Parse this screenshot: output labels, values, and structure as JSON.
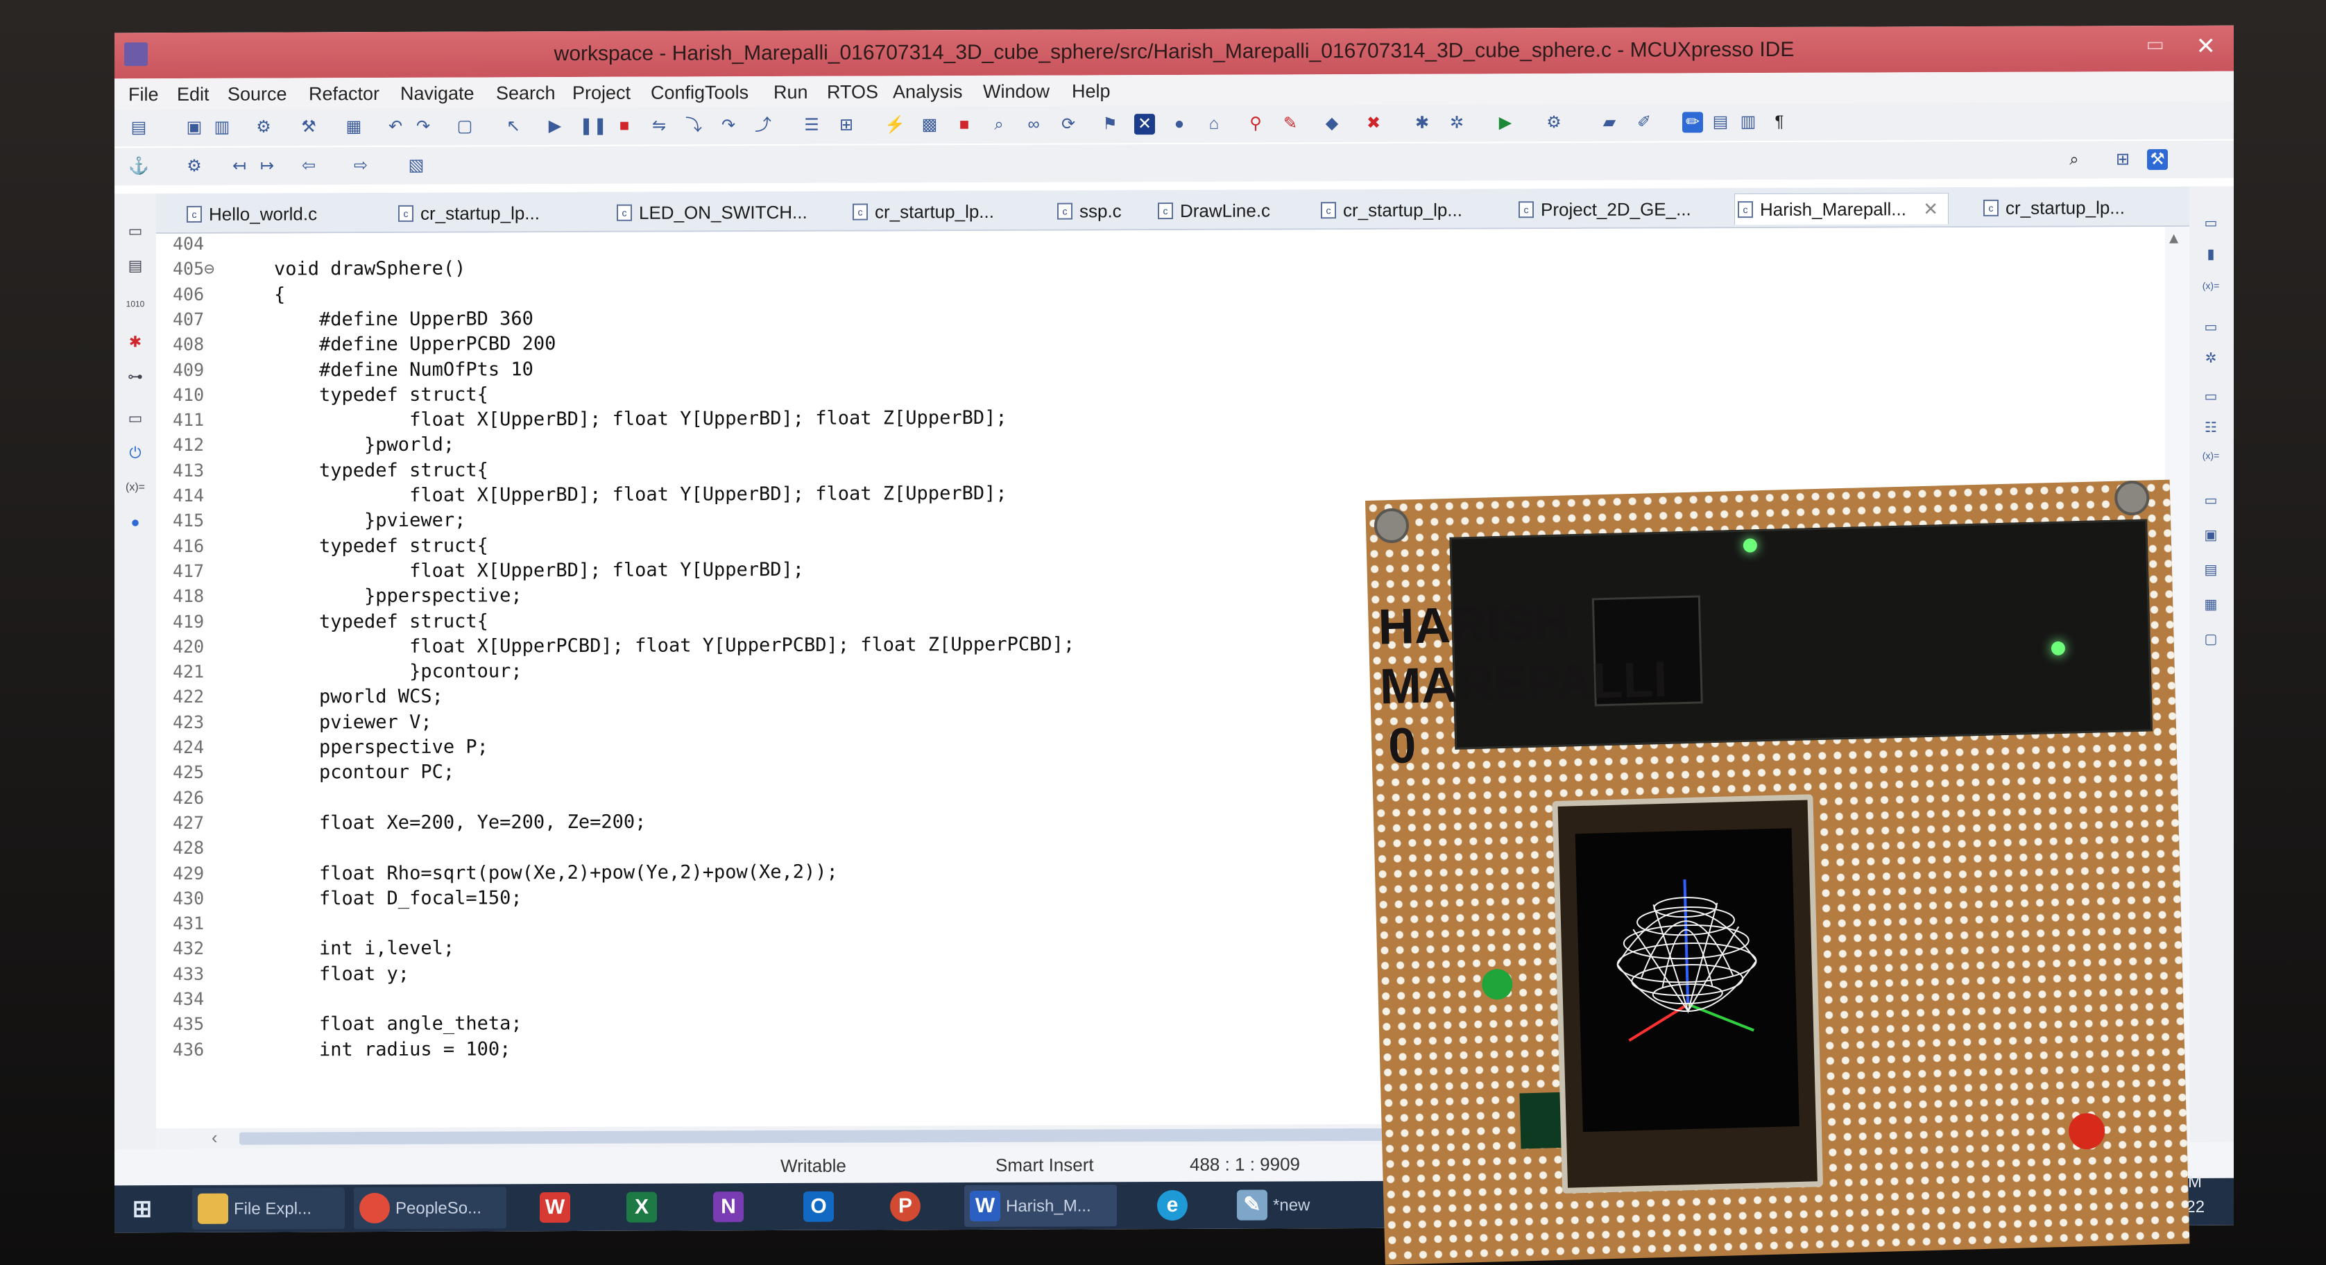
{
  "window": {
    "title": "workspace - Harish_Marepalli_016707314_3D_cube_sphere/src/Harish_Marepalli_016707314_3D_cube_sphere.c - MCUXpresso IDE",
    "close_glyph": "✕",
    "max_glyph": "▭"
  },
  "menu": [
    "File",
    "Edit",
    "Source",
    "Refactor",
    "Navigate",
    "Search",
    "Project",
    "ConfigTools",
    "Run",
    "RTOS",
    "Analysis",
    "Window",
    "Help"
  ],
  "tabs": [
    {
      "label": "Hello_world.c"
    },
    {
      "label": "cr_startup_lp..."
    },
    {
      "label": "LED_ON_SWITCH..."
    },
    {
      "label": "cr_startup_lp..."
    },
    {
      "label": "ssp.c"
    },
    {
      "label": "DrawLine.c"
    },
    {
      "label": "cr_startup_lp..."
    },
    {
      "label": "Project_2D_GE_..."
    },
    {
      "label": "Harish_Marepall...",
      "active": true
    },
    {
      "label": "cr_startup_lp..."
    }
  ],
  "tab_close_glyph": "✕",
  "file_icon_glyph": "c",
  "code_lines": [
    {
      "n": "404",
      "t": ""
    },
    {
      "n": "405⊖",
      "t": "void drawSphere()"
    },
    {
      "n": "406",
      "t": "{"
    },
    {
      "n": "407",
      "t": "    #define UpperBD 360"
    },
    {
      "n": "408",
      "t": "    #define UpperPCBD 200"
    },
    {
      "n": "409",
      "t": "    #define NumOfPts 10"
    },
    {
      "n": "410",
      "t": "    typedef struct{"
    },
    {
      "n": "411",
      "t": "            float X[UpperBD]; float Y[UpperBD]; float Z[UpperBD];"
    },
    {
      "n": "412",
      "t": "        }pworld;"
    },
    {
      "n": "413",
      "t": "    typedef struct{"
    },
    {
      "n": "414",
      "t": "            float X[UpperBD]; float Y[UpperBD]; float Z[UpperBD];"
    },
    {
      "n": "415",
      "t": "        }pviewer;"
    },
    {
      "n": "416",
      "t": "    typedef struct{"
    },
    {
      "n": "417",
      "t": "            float X[UpperBD]; float Y[UpperBD];"
    },
    {
      "n": "418",
      "t": "        }pperspective;"
    },
    {
      "n": "419",
      "t": "    typedef struct{"
    },
    {
      "n": "420",
      "t": "            float X[UpperPCBD]; float Y[UpperPCBD]; float Z[UpperPCBD];"
    },
    {
      "n": "421",
      "t": "            }pcontour;"
    },
    {
      "n": "422",
      "t": "    pworld WCS;"
    },
    {
      "n": "423",
      "t": "    pviewer V;"
    },
    {
      "n": "424",
      "t": "    pperspective P;"
    },
    {
      "n": "425",
      "t": "    pcontour PC;"
    },
    {
      "n": "426",
      "t": ""
    },
    {
      "n": "427",
      "t": "    float Xe=200, Ye=200, Ze=200;"
    },
    {
      "n": "428",
      "t": ""
    },
    {
      "n": "429",
      "t": "    float Rho=sqrt(pow(Xe,2)+pow(Ye,2)+pow(Xe,2));"
    },
    {
      "n": "430",
      "t": "    float D_focal=150;"
    },
    {
      "n": "431",
      "t": ""
    },
    {
      "n": "432",
      "t": "    int i,level;"
    },
    {
      "n": "433",
      "t": "    float y;"
    },
    {
      "n": "434",
      "t": ""
    },
    {
      "n": "435",
      "t": "    float angle_theta;"
    },
    {
      "n": "436",
      "t": "    int radius = 100;"
    }
  ],
  "status": {
    "writable": "Writable",
    "insert_mode": "Smart Insert",
    "position": "488 : 1 : 9909"
  },
  "taskbar": {
    "items": [
      {
        "label": "File Expl...",
        "icon": "folder-icon",
        "glyph": "",
        "color": "#e8b84a"
      },
      {
        "label": "PeopleSo...",
        "icon": "chrome-icon",
        "glyph": "",
        "color": "#e04b3a"
      },
      {
        "label": "",
        "icon": "wps-icon",
        "glyph": "W",
        "color": "#d63a32"
      },
      {
        "label": "",
        "icon": "excel-icon",
        "glyph": "X",
        "color": "#1d7a45"
      },
      {
        "label": "",
        "icon": "onenote-icon",
        "glyph": "N",
        "color": "#7a3cb3"
      },
      {
        "label": "",
        "icon": "outlook-icon",
        "glyph": "O",
        "color": "#1269c4"
      },
      {
        "label": "",
        "icon": "powerpoint-icon",
        "glyph": "P",
        "color": "#d24a32"
      },
      {
        "label": "Harish_M...",
        "icon": "word-icon",
        "glyph": "W",
        "color": "#2b5fc1"
      },
      {
        "label": "",
        "icon": "edge-icon",
        "glyph": "e",
        "color": "#1e9ad6"
      },
      {
        "label": "*new",
        "icon": "notepad-icon",
        "glyph": "✎",
        "color": "#7ea6c8"
      }
    ],
    "clock_time": "8 PM",
    "clock_date": "/2022"
  },
  "board": {
    "name_text": "HARISH MAREPALLI 0",
    "lcd_label": "3D sphere wireframe"
  }
}
